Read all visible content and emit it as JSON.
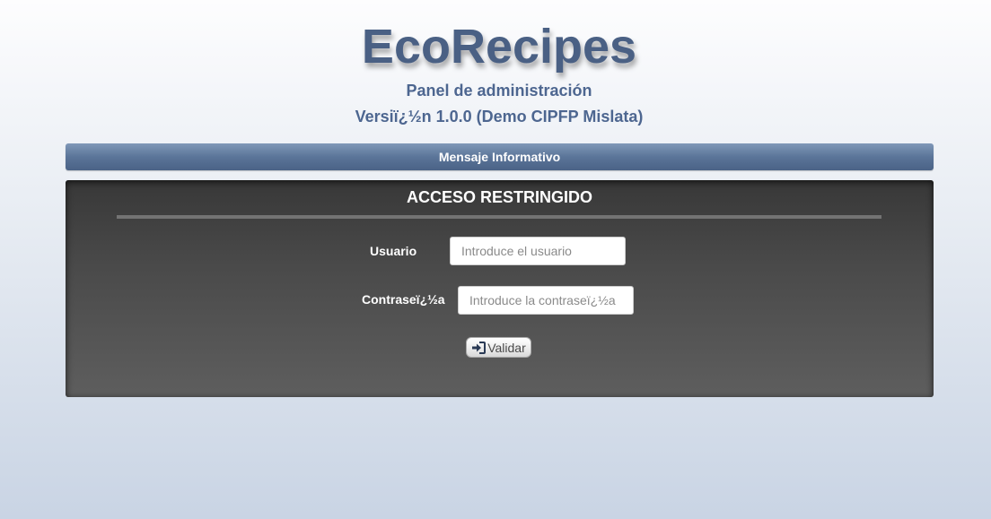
{
  "header": {
    "app_title": "EcoRecipes",
    "subtitle": "Panel de administración",
    "version": "Versiï¿½n 1.0.0 (Demo CIPFP Mislata)"
  },
  "info_bar": {
    "message": "Mensaje Informativo"
  },
  "login_panel": {
    "title": "ACCESO RESTRINGIDO",
    "username_label": "Usuario",
    "username_placeholder": "Introduce el usuario",
    "username_value": "",
    "password_label": "Contraseï¿½a",
    "password_placeholder": "Introduce la contraseï¿½a",
    "password_value": "",
    "validate_label": "Validar",
    "validate_icon": "sign-in-icon"
  },
  "colors": {
    "title": "#4a6084",
    "info_bar": "#5b7599",
    "panel": "#4a4a4a"
  }
}
